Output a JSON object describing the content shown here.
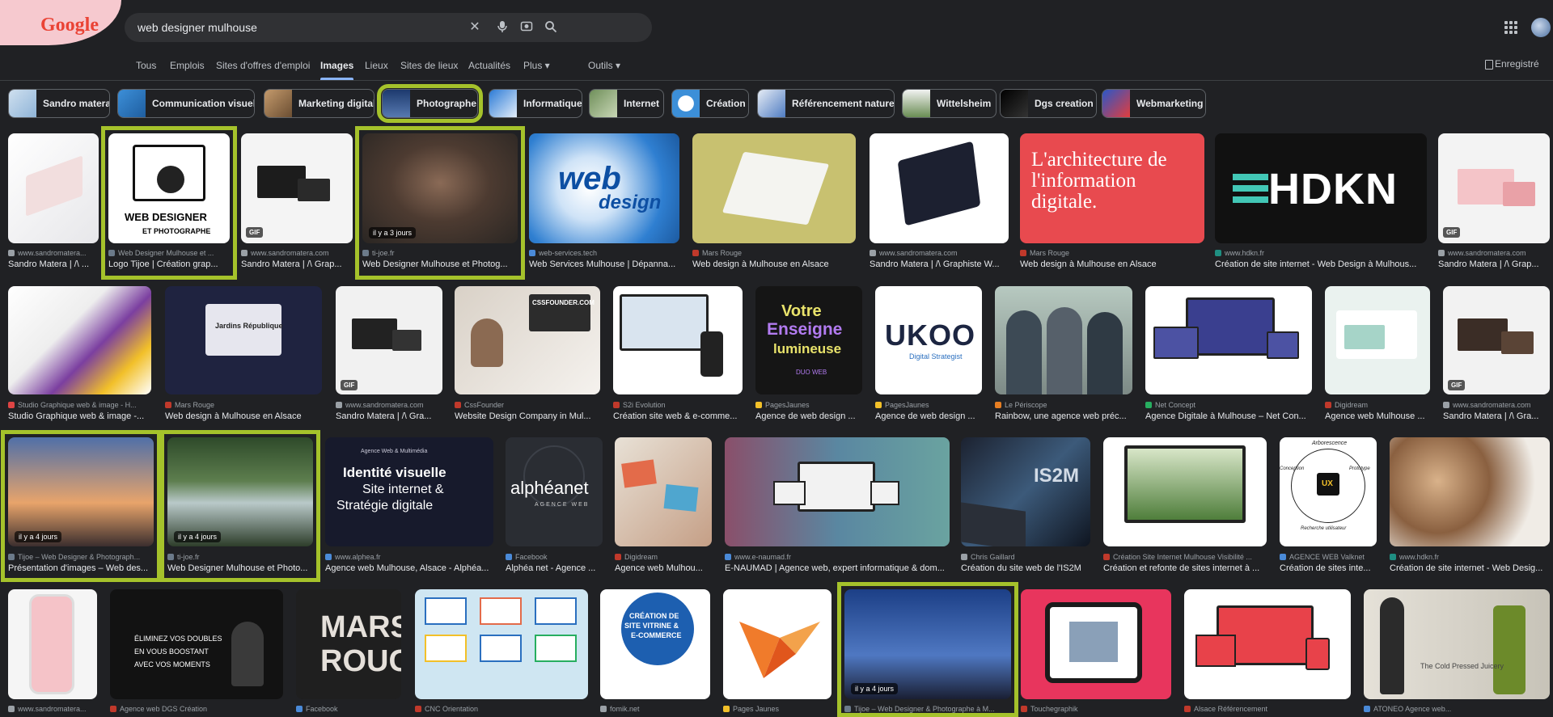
{
  "search": {
    "query": "web designer mulhouse",
    "clear_icon": "close-icon",
    "voice_icon": "mic-icon",
    "lens_icon": "camera-icon",
    "search_icon": "search-icon"
  },
  "logo": {
    "text": "Google"
  },
  "nav": {
    "tabs": [
      "Tous",
      "Emplois",
      "Sites d'offres d'emploi",
      "Images",
      "Lieux",
      "Sites de lieux",
      "Actualités",
      "Plus ▾",
      "Outils ▾"
    ],
    "active": "Images",
    "saved_label": "Enregistré"
  },
  "chips": [
    "Sandro matera",
    "Communication visuelle",
    "Marketing digital",
    "Photographe",
    "Informatique",
    "Internet",
    "Création",
    "Référencement naturel",
    "Wittelsheim",
    "Dgs creation",
    "Webmarketing"
  ],
  "highlight_color": "#a5c22b",
  "results": {
    "row1": [
      {
        "source": "www.sandromatera...",
        "title": "Sandro Matera | /\\ ...",
        "gif": "",
        "age": ""
      },
      {
        "source": "Web Designer Mulhouse et ...",
        "title": "Logo Tijoe | Création grap...",
        "gif": "",
        "age": "",
        "thumb_text": [
          "WEB DESIGNER",
          "ET PHOTOGRAPHE"
        ]
      },
      {
        "source": "www.sandromatera.com",
        "title": "Sandro Matera | /\\ Grap...",
        "gif": "GIF",
        "age": ""
      },
      {
        "source": "ti-joe.fr",
        "title": "Web Designer Mulhouse et Photog...",
        "gif": "",
        "age": "il y a 3 jours"
      },
      {
        "source": "web-services.tech",
        "title": "Web Services Mulhouse | Dépanna...",
        "gif": "",
        "age": "",
        "thumb_text": [
          "web",
          "design"
        ]
      },
      {
        "source": "Mars Rouge",
        "title": "Web design à Mulhouse en Alsace",
        "gif": "",
        "age": ""
      },
      {
        "source": "www.sandromatera.com",
        "title": "Sandro Matera | /\\ Graphiste W...",
        "gif": "",
        "age": ""
      },
      {
        "source": "Mars Rouge",
        "title": "Web design à Mulhouse en Alsace",
        "gif": "",
        "age": "",
        "thumb_text": [
          "L'architecture de",
          "l'information",
          "digitale."
        ]
      },
      {
        "source": "www.hdkn.fr",
        "title": "Création de site internet - Web Design à Mulhous...",
        "gif": "",
        "age": "",
        "thumb_text": [
          "HDKN"
        ]
      },
      {
        "source": "www.sandromatera.com",
        "title": "Sandro Matera | /\\ Grap...",
        "gif": "GIF",
        "age": ""
      }
    ],
    "row2": [
      {
        "source": "Studio Graphique web & image - H...",
        "title": "Studio Graphique web & image -...",
        "gif": "",
        "age": ""
      },
      {
        "source": "Mars Rouge",
        "title": "Web design à Mulhouse en Alsace",
        "gif": "",
        "age": "",
        "thumb_text": [
          "Jardins République"
        ]
      },
      {
        "source": "www.sandromatera.com",
        "title": "Sandro Matera | /\\ Gra...",
        "gif": "GIF",
        "age": ""
      },
      {
        "source": "CssFounder",
        "title": "Website Design Company in Mul...",
        "gif": "",
        "age": "",
        "thumb_text": [
          "CSSFOUNDER.COM"
        ]
      },
      {
        "source": "S2i Evolution",
        "title": "Création site web & e-comme...",
        "gif": "",
        "age": ""
      },
      {
        "source": "PagesJaunes",
        "title": "Agence de web design ...",
        "gif": "",
        "age": "",
        "thumb_text": [
          "Votre",
          "Enseigne",
          "lumineuse",
          "DUO WEB"
        ]
      },
      {
        "source": "PagesJaunes",
        "title": "Agence de web design ...",
        "gif": "",
        "age": "",
        "thumb_text": [
          "UKOO",
          "Digital Strategist"
        ]
      },
      {
        "source": "Le Périscope",
        "title": "Rainbow, une agence web préc...",
        "gif": "",
        "age": ""
      },
      {
        "source": "Net Concept",
        "title": "Agence Digitale à Mulhouse – Net Con...",
        "gif": "",
        "age": ""
      },
      {
        "source": "Digidream",
        "title": "Agence web Mulhouse ...",
        "gif": "",
        "age": ""
      },
      {
        "source": "www.sandromatera.com",
        "title": "Sandro Matera | /\\ Gra...",
        "gif": "GIF",
        "age": ""
      }
    ],
    "row3": [
      {
        "source": "Tijoe – Web Designer & Photograph...",
        "title": "Présentation d'images – Web des...",
        "gif": "",
        "age": "il y a 4 jours"
      },
      {
        "source": "ti-joe.fr",
        "title": "Web Designer Mulhouse et Photo...",
        "gif": "",
        "age": "il y a 4 jours"
      },
      {
        "source": "www.alphea.fr",
        "title": "Agence web Mulhouse, Alsace - Alphéa...",
        "gif": "",
        "age": "",
        "thumb_text": [
          "Agence Web & Multimédia",
          "Identité visuelle",
          "Site internet &",
          "Stratégie digitale"
        ]
      },
      {
        "source": "Facebook",
        "title": "Alphéa net - Agence ...",
        "gif": "",
        "age": "",
        "thumb_text": [
          "alphéanet",
          "AGENCE WEB"
        ]
      },
      {
        "source": "Digidream",
        "title": "Agence web Mulhou...",
        "gif": "",
        "age": ""
      },
      {
        "source": "www.e-naumad.fr",
        "title": "E-NAUMAD | Agence web, expert informatique & dom...",
        "gif": "",
        "age": ""
      },
      {
        "source": "Chris Gaillard",
        "title": "Création du site web de l'IS2M",
        "gif": "",
        "age": "",
        "thumb_text": [
          "IS2M"
        ]
      },
      {
        "source": "Création Site Internet Mulhouse Visibilité ...",
        "title": "Création et refonte de sites internet à ...",
        "gif": "",
        "age": ""
      },
      {
        "source": "AGENCE WEB Valknet",
        "title": "Création de sites inte...",
        "gif": "",
        "age": "",
        "thumb_text": [
          "Arborescence",
          "UX",
          "Prototype",
          "Conception",
          "Recherche utilisateur"
        ]
      },
      {
        "source": "www.hdkn.fr",
        "title": "Création de site internet - Web Desig...",
        "gif": "",
        "age": ""
      }
    ],
    "row4": [
      {
        "source": "www.sandromatera...",
        "title": "",
        "gif": "",
        "age": ""
      },
      {
        "source": "Agence web DGS Création",
        "title": "",
        "gif": "",
        "age": "",
        "thumb_text": [
          "ÉLIMINEZ VOS DOUBLES",
          "EN VOUS BOOSTANT",
          "AVEC VOS MOMENTS"
        ]
      },
      {
        "source": "Facebook",
        "title": "",
        "gif": "",
        "age": "",
        "thumb_text": [
          "MARS",
          "ROUGE"
        ]
      },
      {
        "source": "CNC Orientation",
        "title": "",
        "gif": "",
        "age": ""
      },
      {
        "source": "fomik.net",
        "title": "",
        "gif": "",
        "age": "",
        "thumb_text": [
          "CRÉATION DE",
          "SITE VITRINE &",
          "E-COMMERCE"
        ]
      },
      {
        "source": "Pages Jaunes",
        "title": "",
        "gif": "",
        "age": ""
      },
      {
        "source": "Tijoe – Web Designer & Photographe à M...",
        "title": "",
        "gif": "",
        "age": "il y a 4 jours"
      },
      {
        "source": "Touchegraphik",
        "title": "",
        "gif": "",
        "age": ""
      },
      {
        "source": "Alsace Référencement",
        "title": "",
        "gif": "",
        "age": ""
      },
      {
        "source": "ATONEO Agence web...",
        "title": "",
        "gif": "",
        "age": "",
        "thumb_text": [
          "The Cold Pressed Juicery"
        ]
      }
    ]
  }
}
